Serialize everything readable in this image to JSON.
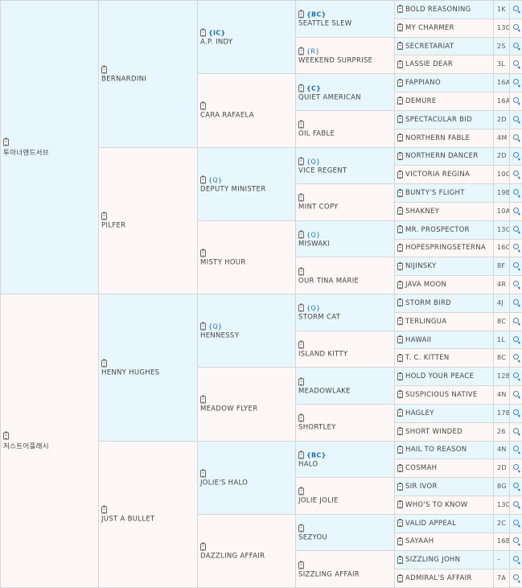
{
  "gen1": [
    {
      "name": "투아너앤드서브"
    },
    {
      "name": "저스트어플래시"
    }
  ],
  "gen2": [
    {
      "name": "BERNARDINI"
    },
    {
      "name": "PILFER"
    },
    {
      "name": "HENNY HUGHES"
    },
    {
      "name": "JUST A BULLET"
    }
  ],
  "gen3": [
    {
      "name": "A.P. INDY",
      "badge": "{IC}"
    },
    {
      "name": "CARA RAFAELA",
      "badge": ""
    },
    {
      "name": "DEPUTY MINISTER",
      "badge": "{Q}"
    },
    {
      "name": "MISTY HOUR",
      "badge": ""
    },
    {
      "name": "HENNESSY",
      "badge": "{Q}"
    },
    {
      "name": "MEADOW FLYER",
      "badge": ""
    },
    {
      "name": "JOLIE'S HALO",
      "badge": ""
    },
    {
      "name": "DAZZLING AFFAIR",
      "badge": ""
    }
  ],
  "gen4": [
    {
      "name": "SEATTLE SLEW",
      "badge": "{BC}"
    },
    {
      "name": "WEEKEND SURPRISE",
      "badge": "{R}"
    },
    {
      "name": "QUIET AMERICAN",
      "badge": "{C}"
    },
    {
      "name": "OIL FABLE",
      "badge": ""
    },
    {
      "name": "VICE REGENT",
      "badge": "{Q}"
    },
    {
      "name": "MINT COPY",
      "badge": ""
    },
    {
      "name": "MISWAKI",
      "badge": "{Q}"
    },
    {
      "name": "OUR TINA MARIE",
      "badge": ""
    },
    {
      "name": "STORM CAT",
      "badge": "{Q}"
    },
    {
      "name": "ISLAND KITTY",
      "badge": ""
    },
    {
      "name": "MEADOWLAKE",
      "badge": ""
    },
    {
      "name": "SHORTLEY",
      "badge": ""
    },
    {
      "name": "HALO",
      "badge": "{BC}"
    },
    {
      "name": "JOLIE JOLIE",
      "badge": ""
    },
    {
      "name": "SEZYOU",
      "badge": ""
    },
    {
      "name": "SIZZLING AFFAIR",
      "badge": ""
    }
  ],
  "gen5": [
    {
      "name": "BOLD REASONING",
      "num": "1K"
    },
    {
      "name": "MY CHARMER",
      "num": "13C"
    },
    {
      "name": "SECRETARIAT",
      "num": "2S"
    },
    {
      "name": "LASSIE DEAR",
      "num": "3L"
    },
    {
      "name": "FAPPIANO",
      "num": "16A"
    },
    {
      "name": "DEMURE",
      "num": "16A"
    },
    {
      "name": "SPECTACULAR BID",
      "num": "2D"
    },
    {
      "name": "NORTHERN FABLE",
      "num": "4M"
    },
    {
      "name": "NORTHERN DANCER",
      "num": "2D"
    },
    {
      "name": "VICTORIA REGINA",
      "num": "10C"
    },
    {
      "name": "BUNTY'S FLIGHT",
      "num": "19B"
    },
    {
      "name": "SHAKNEY",
      "num": "10A"
    },
    {
      "name": "MR. PROSPECTOR",
      "num": "13C"
    },
    {
      "name": "HOPESPRINGSETERNA",
      "num": "16C"
    },
    {
      "name": "NIJINSKY",
      "num": "8F"
    },
    {
      "name": "JAVA MOON",
      "num": "4R"
    },
    {
      "name": "STORM BIRD",
      "num": "4J"
    },
    {
      "name": "TERLINGUA",
      "num": "8C"
    },
    {
      "name": "HAWAII",
      "num": "1L"
    },
    {
      "name": "T. C. KITTEN",
      "num": "8C"
    },
    {
      "name": "HOLD YOUR PEACE",
      "num": "12B"
    },
    {
      "name": "SUSPICIOUS NATIVE",
      "num": "4N"
    },
    {
      "name": "HAGLEY",
      "num": "17B"
    },
    {
      "name": "SHORT WINDED",
      "num": "26"
    },
    {
      "name": "HAIL TO REASON",
      "num": "4N"
    },
    {
      "name": "COSMAH",
      "num": "2D"
    },
    {
      "name": "SIR IVOR",
      "num": "8G"
    },
    {
      "name": "WHO'S TO KNOW",
      "num": "13C"
    },
    {
      "name": "VALID APPEAL",
      "num": "2C"
    },
    {
      "name": "SAYAAH",
      "num": "16B"
    },
    {
      "name": "SIZZLING JOHN",
      "num": "–"
    },
    {
      "name": "ADMIRAL'S AFFAIR",
      "num": "7A"
    }
  ],
  "icons": {
    "clipboard": "clipboard-icon",
    "search": "search-icon"
  },
  "colors": {
    "male_bg": "#e8f7fd",
    "female_bg": "#fdf7f7",
    "badge": "#1d6fb0",
    "border": "#d6d6d6"
  }
}
